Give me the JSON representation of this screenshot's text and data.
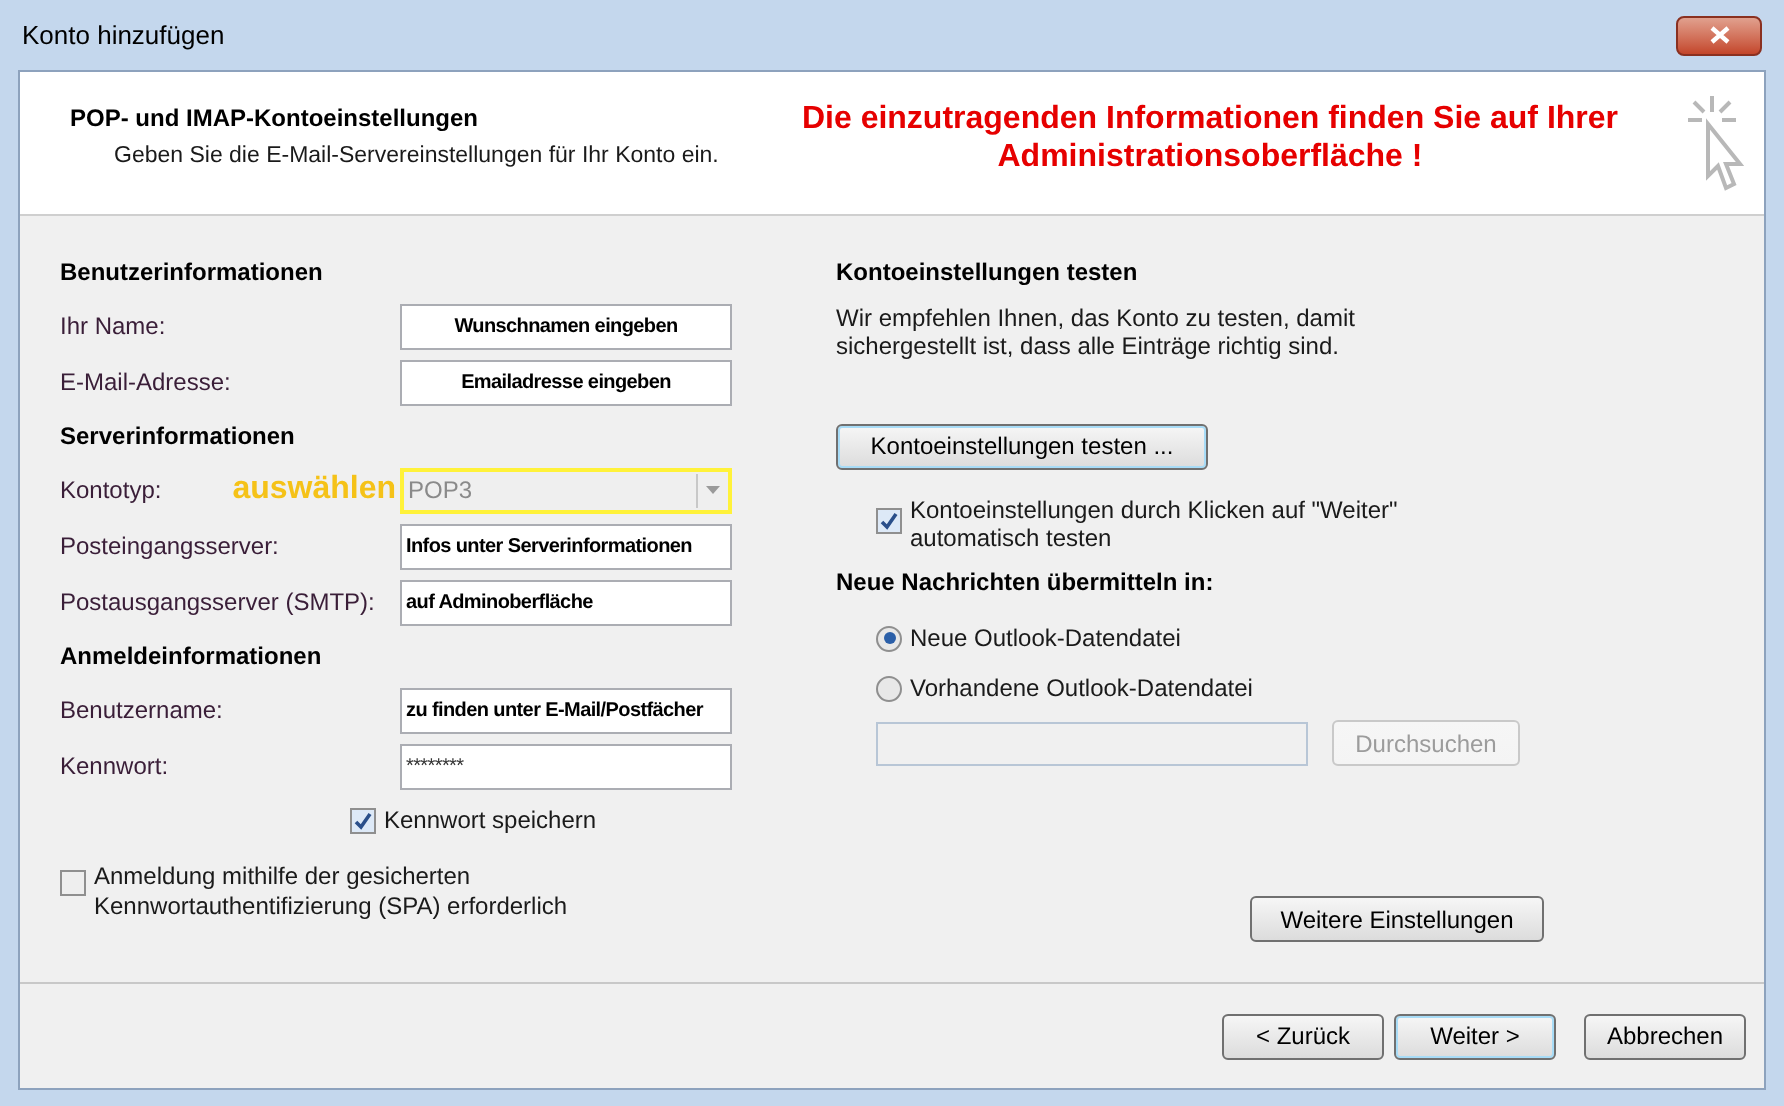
{
  "window": {
    "title": "Konto hinzufügen"
  },
  "header": {
    "title": "POP- und IMAP-Kontoeinstellungen",
    "subtitle": "Geben Sie die E-Mail-Servereinstellungen für Ihr Konto ein.",
    "notice": "Die einzutragenden Informationen finden Sie auf Ihrer Administrationsoberfläche !"
  },
  "left_sections": [
    {
      "heading": "Benutzerinformationen",
      "fields": [
        {
          "kind": "text",
          "label": "Ihr Name:",
          "value": "Wunschnamen eingeben"
        },
        {
          "kind": "text",
          "label": "E-Mail-Adresse:",
          "value": "Emailadresse eingeben"
        }
      ]
    },
    {
      "heading": "Serverinformationen",
      "fields": [
        {
          "kind": "dropdown",
          "label": "Kontotyp:",
          "annotation": "auswählen",
          "value": "POP3",
          "disabled": true
        },
        {
          "kind": "text",
          "label": "Posteingangsserver:",
          "value": "Infos unter Serverinformationen"
        },
        {
          "kind": "text",
          "label": "Postausgangsserver (SMTP):",
          "value": "auf Adminoberfläche"
        }
      ]
    },
    {
      "heading": "Anmeldeinformationen",
      "fields": [
        {
          "kind": "text",
          "label": "Benutzername:",
          "value": "zu finden unter E-Mail/Postfächer"
        },
        {
          "kind": "password",
          "label": "Kennwort:",
          "value": "********"
        }
      ]
    }
  ],
  "remember_password": {
    "label": "Kennwort speichern",
    "checked": true
  },
  "spa": {
    "label": "Anmeldung mithilfe der gesicherten Kennwortauthentifizierung (SPA) erforderlich",
    "checked": false
  },
  "test": {
    "heading": "Kontoeinstellungen testen",
    "description": "Wir empfehlen Ihnen, das Konto zu testen, damit sichergestellt ist, dass alle Einträge richtig sind.",
    "button": "Kontoeinstellungen testen ...",
    "auto_test": {
      "label": "Kontoeinstellungen durch Klicken auf \"Weiter\" automatisch testen",
      "checked": true
    }
  },
  "delivery": {
    "heading": "Neue Nachrichten übermitteln in:",
    "options": [
      {
        "label": "Neue Outlook-Datendatei",
        "selected": true
      },
      {
        "label": "Vorhandene Outlook-Datendatei",
        "selected": false
      }
    ],
    "file_field": {
      "disabled": true
    },
    "browse_button": {
      "label": "Durchsuchen",
      "disabled": true
    }
  },
  "more_settings": "Weitere Einstellungen",
  "footer_buttons": [
    {
      "label": "< Zurück",
      "default": false
    },
    {
      "label": "Weiter >",
      "default": true
    },
    {
      "label": "Abbrechen",
      "default": false
    }
  ]
}
